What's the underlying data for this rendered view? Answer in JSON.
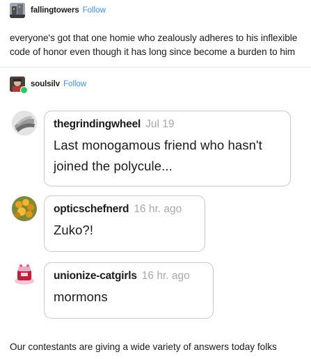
{
  "post1": {
    "author": "fallingtowers",
    "follow_label": "Follow",
    "text": "everyone's got that one homie who zealously adheres to his inflexible code of honor even though it has long since become a burden to him"
  },
  "post2": {
    "author": "soulsilv",
    "follow_label": "Follow"
  },
  "comments": [
    {
      "author": "thegrindingwheel",
      "time": "Jul 19",
      "body": "Last monogamous friend who hasn't joined the polycule..."
    },
    {
      "author": "opticschefnerd",
      "time": "16 hr. ago",
      "body": "Zuko?!"
    },
    {
      "author": "unionize-catgirls",
      "time": "16 hr. ago",
      "body": "mormons"
    }
  ],
  "footer": {
    "text": "Our contestants are giving a wide variety of answers today folks"
  },
  "colors": {
    "follow": "#3c8ff0",
    "timestamp": "#a8a8a8",
    "bubble_border": "#c9c9c9"
  },
  "icons": {
    "post1_avatar": "building-avatar-icon",
    "post2_avatar": "character-avatar-icon",
    "online_badge": "green-badge-icon"
  }
}
